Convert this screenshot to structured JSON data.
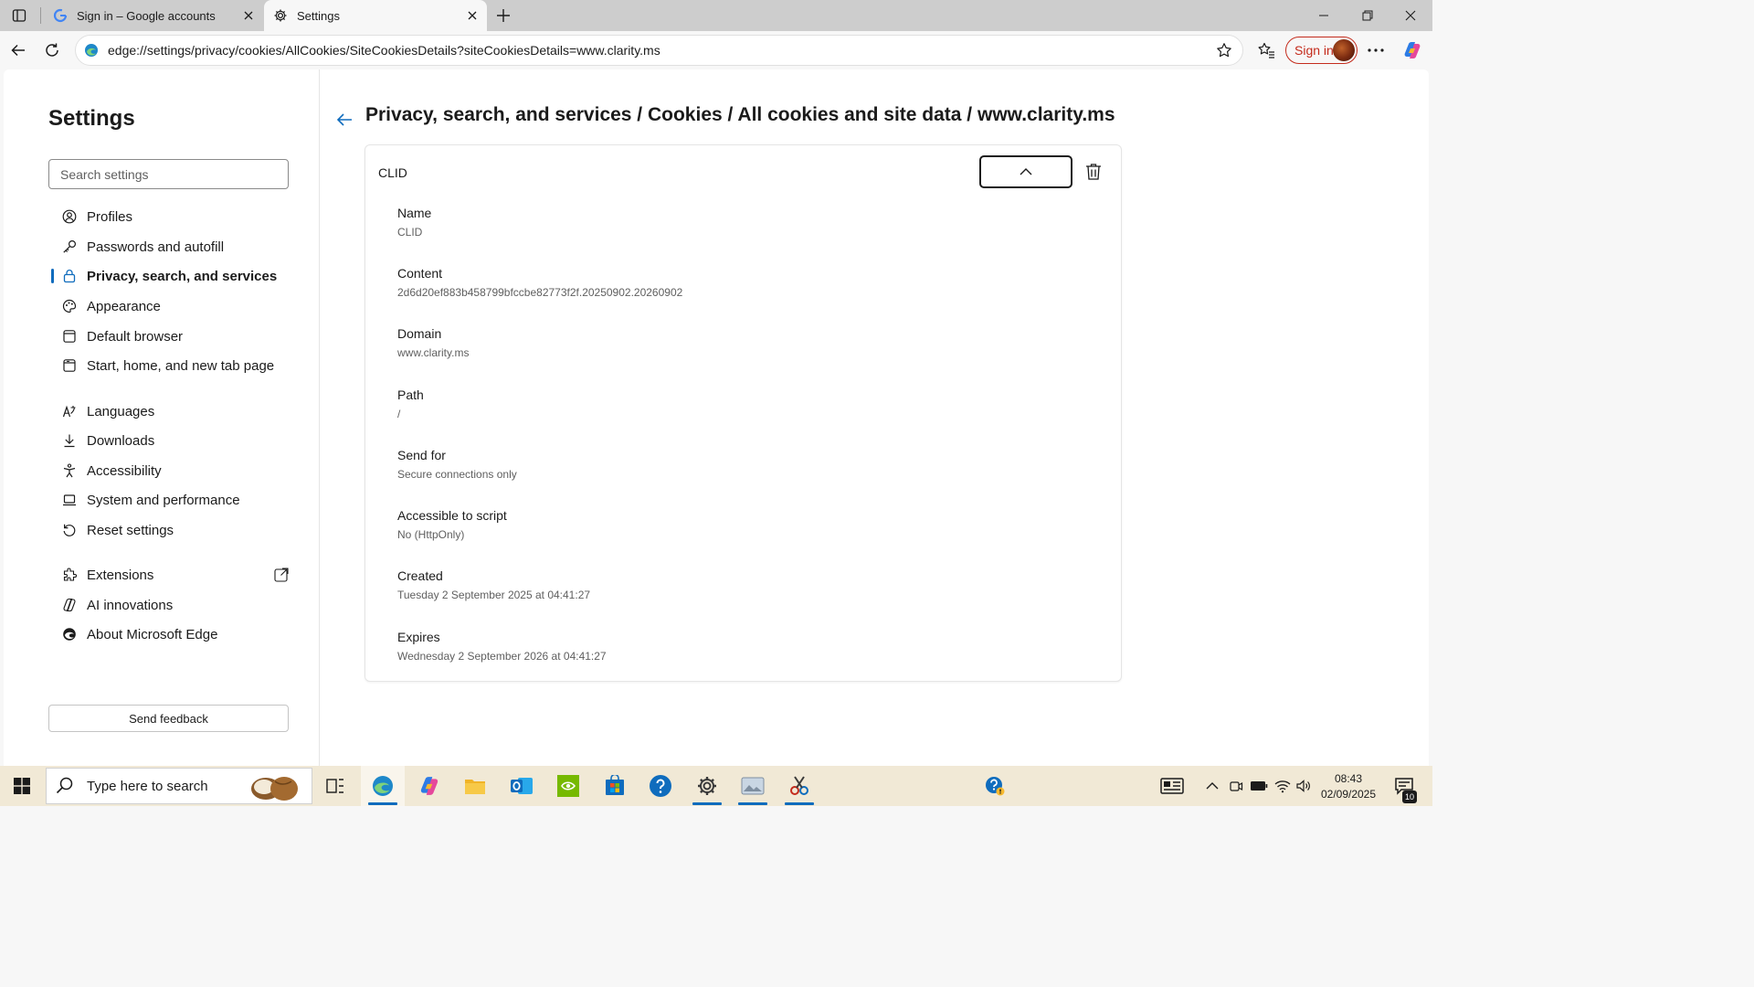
{
  "browser": {
    "tabs": [
      {
        "title": "Sign in – Google accounts"
      },
      {
        "title": "Settings"
      }
    ],
    "url": "edge://settings/privacy/cookies/AllCookies/SiteCookiesDetails?siteCookiesDetails=www.clarity.ms",
    "sign_in_label": "Sign in"
  },
  "sidebar": {
    "title": "Settings",
    "search_placeholder": "Search settings",
    "items": [
      {
        "label": "Profiles",
        "icon": "profile-icon"
      },
      {
        "label": "Passwords and autofill",
        "icon": "key-icon"
      },
      {
        "label": "Privacy, search, and services",
        "icon": "lock-icon",
        "active": true
      },
      {
        "label": "Appearance",
        "icon": "palette-icon"
      },
      {
        "label": "Default browser",
        "icon": "browser-icon"
      },
      {
        "label": "Start, home, and new tab page",
        "icon": "home-icon"
      },
      {
        "label": "Languages",
        "icon": "languages-icon"
      },
      {
        "label": "Downloads",
        "icon": "download-icon"
      },
      {
        "label": "Accessibility",
        "icon": "accessibility-icon"
      },
      {
        "label": "System and performance",
        "icon": "laptop-icon"
      },
      {
        "label": "Reset settings",
        "icon": "reset-icon"
      },
      {
        "label": "Extensions",
        "icon": "puzzle-icon"
      },
      {
        "label": "AI innovations",
        "icon": "ai-icon"
      },
      {
        "label": "About Microsoft Edge",
        "icon": "edge-icon"
      }
    ],
    "feedback_label": "Send feedback"
  },
  "main": {
    "breadcrumb": "Privacy, search, and services / Cookies / All cookies and site data / www.clarity.ms",
    "cookie": {
      "header": "CLID",
      "fields": [
        {
          "label": "Name",
          "value": "CLID"
        },
        {
          "label": "Content",
          "value": "2d6d20ef883b458799bfccbe82773f2f.20250902.20260902"
        },
        {
          "label": "Domain",
          "value": "www.clarity.ms"
        },
        {
          "label": "Path",
          "value": "/"
        },
        {
          "label": "Send for",
          "value": "Secure connections only"
        },
        {
          "label": "Accessible to script",
          "value": "No (HttpOnly)"
        },
        {
          "label": "Created",
          "value": "Tuesday 2 September 2025 at 04:41:27"
        },
        {
          "label": "Expires",
          "value": "Wednesday 2 September 2026 at 04:41:27"
        }
      ]
    }
  },
  "taskbar": {
    "search_placeholder": "Type here to search",
    "time": "08:43",
    "date": "02/09/2025",
    "notification_count": "10"
  },
  "colors": {
    "accent": "#0f6cbd",
    "signin_red": "#c42b1c",
    "taskbar_bg": "#f1e9d6"
  }
}
